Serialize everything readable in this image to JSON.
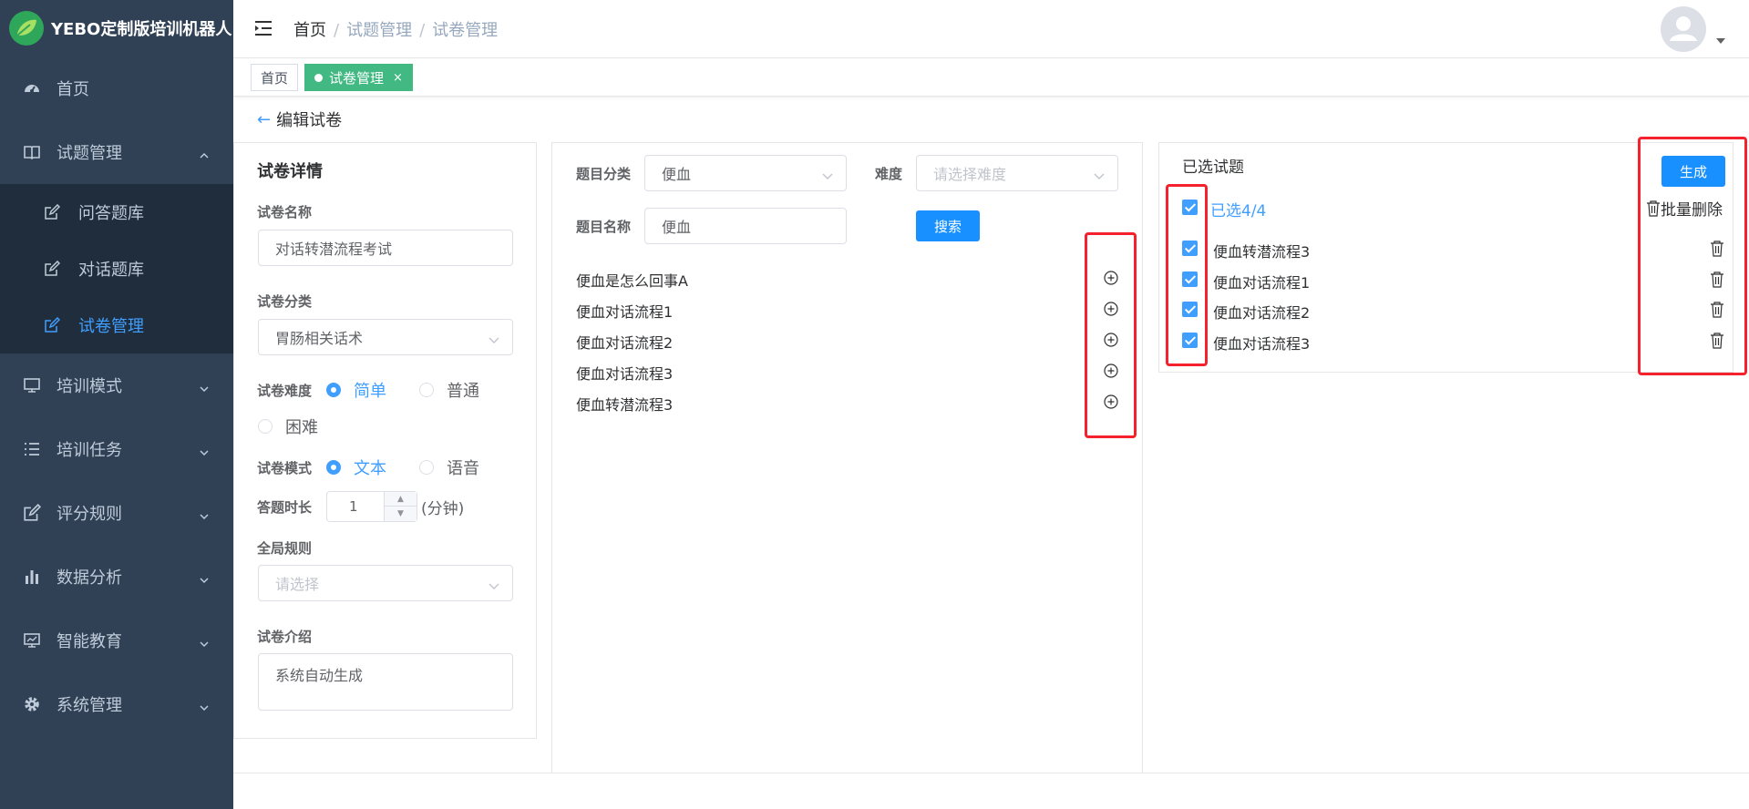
{
  "app": {
    "title": "YEBO定制版培训机器人"
  },
  "sidebar": {
    "items": [
      {
        "label": "首页",
        "icon": "dashboard-icon"
      },
      {
        "label": "试题管理",
        "icon": "book-icon",
        "expanded": true
      },
      {
        "label": "培训模式",
        "icon": "monitor-icon"
      },
      {
        "label": "培训任务",
        "icon": "list-icon"
      },
      {
        "label": "评分规则",
        "icon": "edit-icon"
      },
      {
        "label": "数据分析",
        "icon": "bar-chart-icon"
      },
      {
        "label": "智能教育",
        "icon": "monitor-chart-icon"
      },
      {
        "label": "系统管理",
        "icon": "gear-icon"
      }
    ],
    "sub": [
      {
        "label": "问答题库"
      },
      {
        "label": "对话题库"
      },
      {
        "label": "试卷管理",
        "active": true
      }
    ]
  },
  "breadcrumb": [
    "首页",
    "试题管理",
    "试卷管理"
  ],
  "tags": [
    {
      "label": "首页"
    },
    {
      "label": "试卷管理",
      "close": "×",
      "active": true
    }
  ],
  "page": {
    "back_label": "编辑试卷"
  },
  "details": {
    "title": "试卷详情",
    "name_label": "试卷名称",
    "name_value": "对话转潜流程考试",
    "category_label": "试卷分类",
    "category_value": "胃肠相关话术",
    "difficulty_label": "试卷难度",
    "difficulty_options": [
      "简单",
      "普通",
      "困难"
    ],
    "difficulty_selected": "简单",
    "mode_label": "试卷模式",
    "mode_options": [
      "文本",
      "语音"
    ],
    "mode_selected": "文本",
    "duration_label": "答题时长",
    "duration_value": "1",
    "duration_unit": "(分钟)",
    "rule_label": "全局规则",
    "rule_placeholder": "请选择",
    "intro_label": "试卷介绍",
    "intro_value": "系统自动生成"
  },
  "filter": {
    "category_label": "题目分类",
    "category_value": "便血",
    "difficulty_label": "难度",
    "difficulty_placeholder": "请选择难度",
    "name_label": "题目名称",
    "name_value": "便血",
    "search_label": "搜索"
  },
  "questions": [
    "便血是怎么回事A",
    "便血对话流程1",
    "便血对话流程2",
    "便血对话流程3",
    "便血转潜流程3"
  ],
  "selected": {
    "title": "已选试题",
    "generate_label": "生成",
    "count_label": "已选4/4",
    "batch_delete_label": "批量删除",
    "items": [
      "便血转潜流程3",
      "便血对话流程1",
      "便血对话流程2",
      "便血对话流程3"
    ]
  },
  "colors": {
    "sidebar": "#304156",
    "accent": "#409eff",
    "tag_active": "#42b983",
    "highlight": "#f5222d"
  }
}
